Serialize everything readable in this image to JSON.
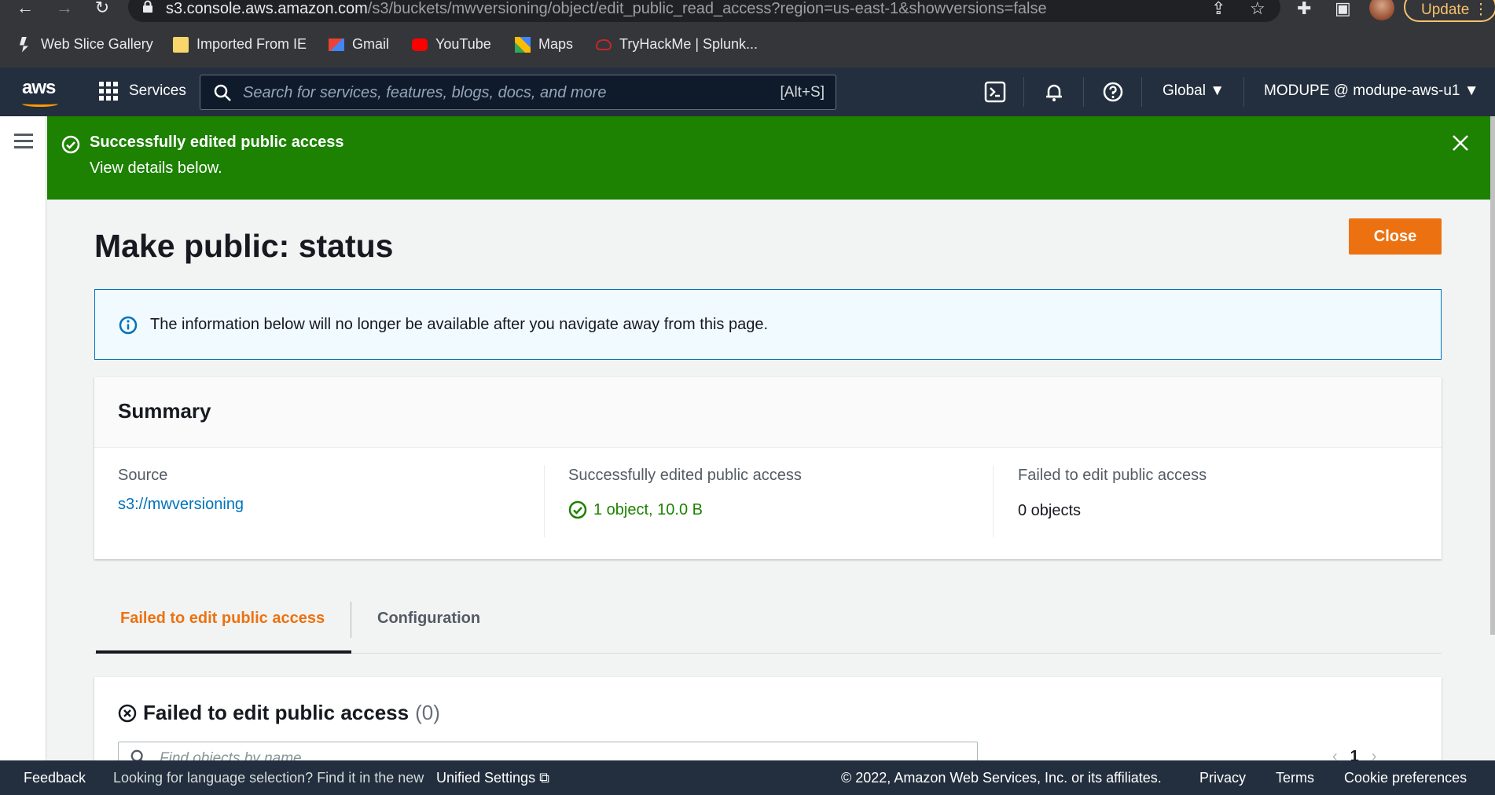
{
  "browser": {
    "url_host": "s3.console.aws.amazon.com",
    "url_path": "/s3/buckets/mwversioning/object/edit_public_read_access?region=us-east-1&showversions=false",
    "update_label": "Update",
    "bookmarks": [
      {
        "label": "Web Slice Gallery",
        "icon": "web-slice-icon"
      },
      {
        "label": "Imported From IE",
        "icon": "folder-icon"
      },
      {
        "label": "Gmail",
        "icon": "gmail-icon"
      },
      {
        "label": "YouTube",
        "icon": "youtube-icon"
      },
      {
        "label": "Maps",
        "icon": "maps-icon"
      },
      {
        "label": "TryHackMe | Splunk...",
        "icon": "cloud-icon"
      }
    ]
  },
  "awsnav": {
    "logo": "aws",
    "services_label": "Services",
    "search_placeholder": "Search for services, features, blogs, docs, and more",
    "search_shortcut": "[Alt+S]",
    "region_label": "Global ▼",
    "account_label": "MODUPE @ modupe-aws-u1 ▼"
  },
  "flash": {
    "title": "Successfully edited public access",
    "message": "View details below."
  },
  "page": {
    "title": "Make public: status",
    "close_label": "Close",
    "info_text": "The information below will no longer be available after you navigate away from this page."
  },
  "summary": {
    "heading": "Summary",
    "source_label": "Source",
    "source_value": "s3://mwversioning",
    "success_label": "Successfully edited public access",
    "success_value": "1 object, 10.0 B",
    "failed_label": "Failed to edit public access",
    "failed_value": "0 objects"
  },
  "tabs": [
    {
      "label": "Failed to edit public access",
      "active": true
    },
    {
      "label": "Configuration",
      "active": false
    }
  ],
  "failed_panel": {
    "title": "Failed to edit public access",
    "count": "(0)",
    "search_placeholder": "Find objects by name",
    "page_number": "1"
  },
  "footer": {
    "feedback": "Feedback",
    "lang_note": "Looking for language selection? Find it in the new",
    "unified_settings": "Unified Settings",
    "copyright": "© 2022, Amazon Web Services, Inc. or its affiliates.",
    "privacy": "Privacy",
    "terms": "Terms",
    "cookie": "Cookie preferences"
  },
  "colors": {
    "success_green": "#1d8102",
    "aws_orange": "#ec7211",
    "nav_dark": "#232f3e",
    "link_blue": "#0073bb"
  }
}
